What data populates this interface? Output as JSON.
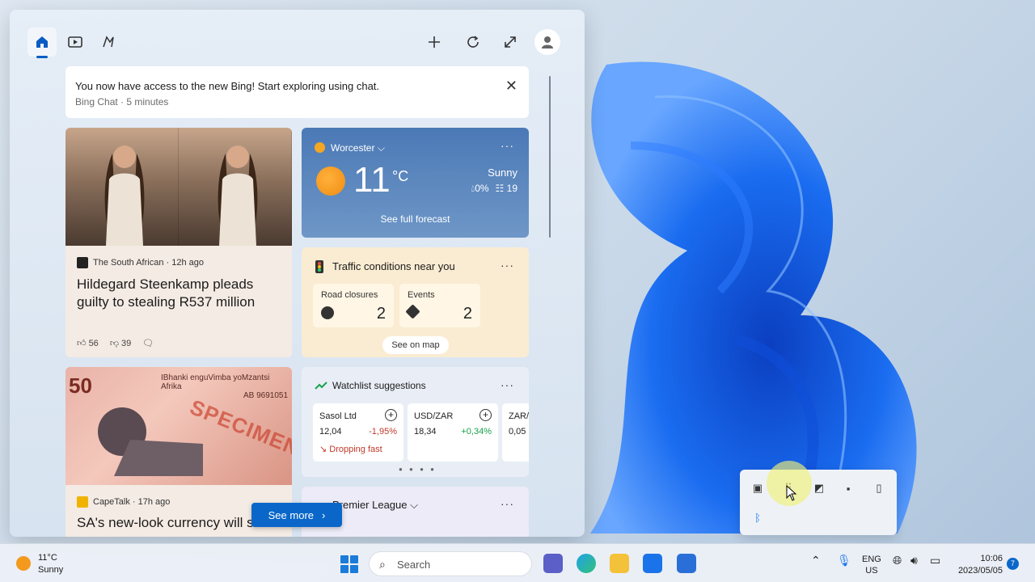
{
  "widgets": {
    "topbar": {
      "home_icon": "home-icon",
      "video_icon": "video-icon",
      "games_icon": "games-icon",
      "add_icon": "plus-icon",
      "refresh_icon": "refresh-icon",
      "expand_icon": "expand-icon",
      "profile_icon": "profile-icon"
    },
    "bing_banner": {
      "message": "You now have access to the new Bing! Start exploring using chat.",
      "source": "Bing Chat · 5 minutes"
    },
    "news1": {
      "source": "The South African · 12h ago",
      "headline": "Hildegard Steenkamp pleads guilty to stealing R537 million",
      "likes": "56",
      "dislikes": "39"
    },
    "news2": {
      "banknote_value": "50",
      "banknote_text": "IBhanki enguVimba yoMzantsi Afrika",
      "serial": "AB 9691051",
      "specimen": "SPECIMEN",
      "source": "CapeTalk · 17h ago",
      "headline": "SA's new-look currency will s"
    },
    "weather": {
      "location": "Worcester",
      "temp": "11",
      "unit": "°C",
      "condition": "Sunny",
      "precip": "0%",
      "aqi": "19",
      "forecast_label": "See full forecast"
    },
    "traffic": {
      "title": "Traffic conditions near you",
      "tiles": [
        {
          "label": "Road closures",
          "value": "2"
        },
        {
          "label": "Events",
          "value": "2"
        }
      ],
      "map_button": "See on map"
    },
    "watchlist": {
      "title": "Watchlist suggestions",
      "stocks": [
        {
          "name": "Sasol Ltd",
          "value": "12,04",
          "change": "-1,95%",
          "trend": "Dropping fast"
        },
        {
          "name": "USD/ZAR",
          "value": "18,34",
          "change": "+0,34%"
        },
        {
          "name": "ZAR/U",
          "value": "0,05"
        }
      ]
    },
    "premier": {
      "title": "Premier League"
    },
    "see_more": "See more"
  },
  "taskbar": {
    "weather_temp": "11°C",
    "weather_cond": "Sunny",
    "search_placeholder": "Search",
    "language": "ENG",
    "region": "US",
    "time": "10:06",
    "date": "2023/05/05",
    "notifications": "7"
  },
  "colors": {
    "accent": "#0a67c9",
    "weather_card": "#4b79b6",
    "traffic_card": "#faecd2"
  }
}
